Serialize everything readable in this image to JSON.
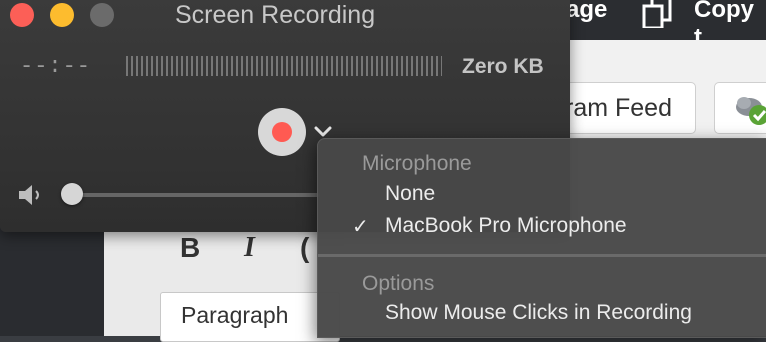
{
  "background_app": {
    "top_partial_left": "age",
    "top_partial_right": "Copy t",
    "feed_button": "ram Feed",
    "toolbar_italic": "I",
    "toolbar_bold": "B",
    "toolbar_partial": "(",
    "format_select": "Paragraph"
  },
  "panel": {
    "title": "Screen Recording",
    "time_readout": "--:--",
    "file_size": "Zero KB",
    "volume_level": 0
  },
  "menu": {
    "microphone_header": "Microphone",
    "microphone_options": [
      {
        "label": "None",
        "checked": false
      },
      {
        "label": "MacBook Pro Microphone",
        "checked": true
      }
    ],
    "options_header": "Options",
    "options_items": [
      {
        "label": "Show Mouse Clicks in Recording"
      }
    ],
    "check_glyph": "✓"
  },
  "colors": {
    "close": "#fc5f57",
    "minimize": "#fdbc2e",
    "record": "#ff5a52"
  }
}
